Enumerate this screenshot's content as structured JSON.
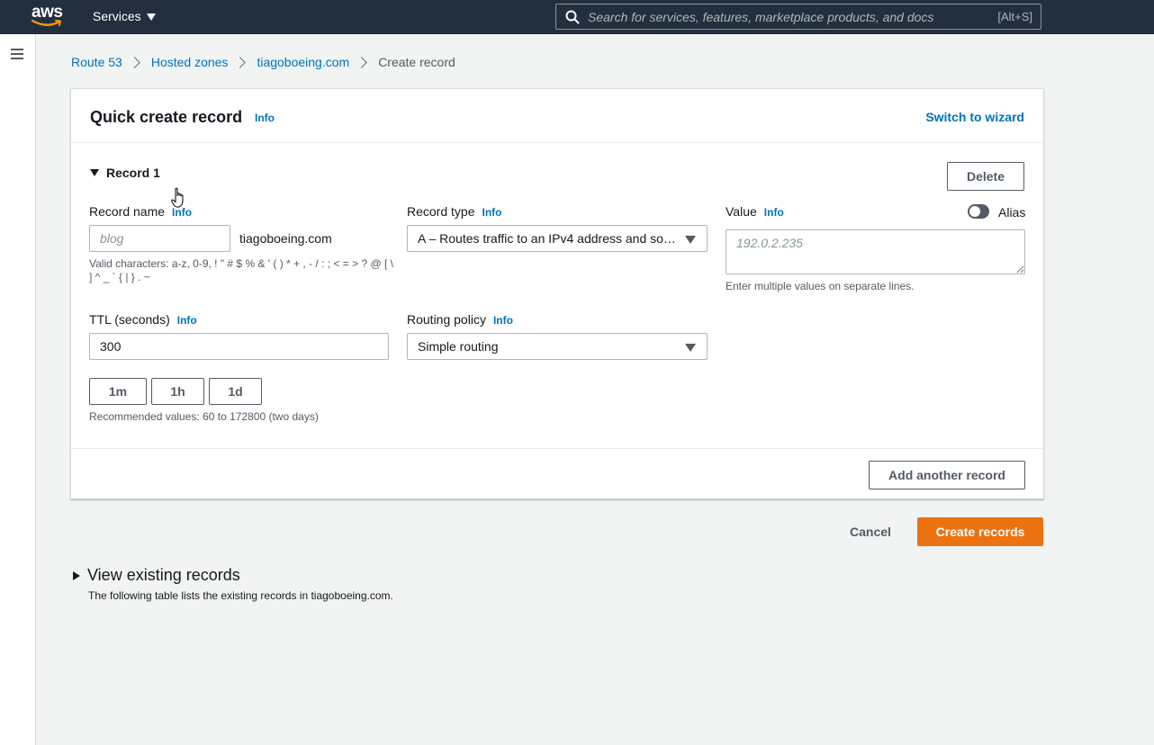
{
  "topnav": {
    "logo_text": "aws",
    "services_label": "Services",
    "search_placeholder": "Search for services, features, marketplace products, and docs",
    "search_shortcut": "[Alt+S]"
  },
  "breadcrumb": {
    "items": [
      "Route 53",
      "Hosted zones",
      "tiagoboeing.com"
    ],
    "current": "Create record"
  },
  "panel": {
    "title": "Quick create record",
    "info": "Info",
    "switch_label": "Switch to wizard",
    "record_label": "Record 1",
    "delete_label": "Delete",
    "record_name": {
      "label": "Record name",
      "info": "Info",
      "placeholder": "blog",
      "suffix": "tiagoboeing.com",
      "hint": "Valid characters: a-z, 0-9, ! \" # $ % & ' ( ) * + , - / : ; < = > ? @ [ \\ ] ^ _ ` { | } . ~"
    },
    "record_type": {
      "label": "Record type",
      "info": "Info",
      "value": "A – Routes traffic to an IPv4 address and so…"
    },
    "value_field": {
      "label": "Value",
      "info": "Info",
      "placeholder": "192.0.2.235",
      "hint": "Enter multiple values on separate lines.",
      "alias_label": "Alias",
      "alias_on": false
    },
    "ttl": {
      "label": "TTL (seconds)",
      "info": "Info",
      "value": "300",
      "btn_1m": "1m",
      "btn_1h": "1h",
      "btn_1d": "1d",
      "hint": "Recommended values: 60 to 172800 (two days)"
    },
    "routing_policy": {
      "label": "Routing policy",
      "info": "Info",
      "value": "Simple routing"
    },
    "add_label": "Add another record"
  },
  "actions": {
    "cancel_label": "Cancel",
    "create_label": "Create records"
  },
  "existing": {
    "title": "View existing records",
    "description": "The following table lists the existing records in tiagoboeing.com."
  },
  "colors": {
    "nav_bg": "#232f3e",
    "link": "#0073bb",
    "primary": "#ec7211",
    "logo_smile": "#ff9900"
  }
}
